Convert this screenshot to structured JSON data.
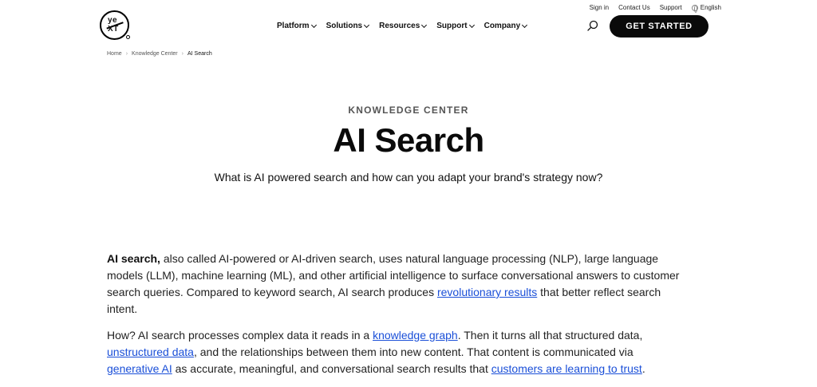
{
  "utility": {
    "sign_in": "Sign in",
    "contact": "Contact Us",
    "support": "Support",
    "language": "English"
  },
  "logo": {
    "top": "ye",
    "bottom": "XT"
  },
  "nav": {
    "items": [
      {
        "label": "Platform"
      },
      {
        "label": "Solutions"
      },
      {
        "label": "Resources"
      },
      {
        "label": "Support"
      },
      {
        "label": "Company"
      }
    ],
    "cta": "GET STARTED"
  },
  "breadcrumb": {
    "items": [
      "Home",
      "Knowledge Center",
      "AI Search"
    ],
    "separator": "›"
  },
  "hero": {
    "eyebrow": "KNOWLEDGE CENTER",
    "title": "AI Search",
    "subtitle": "What is AI powered search and how can you adapt your brand's strategy now?"
  },
  "body": {
    "p1": {
      "lead": "AI search,",
      "text1": " also called AI-powered or AI-driven search, uses natural language processing (NLP), large language models (LLM), machine learning (ML), and other artificial intelligence to surface conversational answers to customer search queries. Compared to keyword search, AI search produces ",
      "link1": "revolutionary results",
      "text2": " that better reflect search intent."
    },
    "p2": {
      "text1": "How? AI search processes complex data it reads in a ",
      "link1": "knowledge graph",
      "text2": ". Then it turns all that structured data, ",
      "link2": "unstructured data",
      "text3": ", and the relationships between them into new content. That content is communicated via ",
      "link3": "generative AI",
      "text4": " as accurate, meaningful, and conversational search results that ",
      "link4": "customers are learning to trust",
      "text5": "."
    }
  },
  "colors": {
    "link": "#1a4fd8",
    "cta_bg": "#0a0a0a",
    "text": "#111111"
  }
}
